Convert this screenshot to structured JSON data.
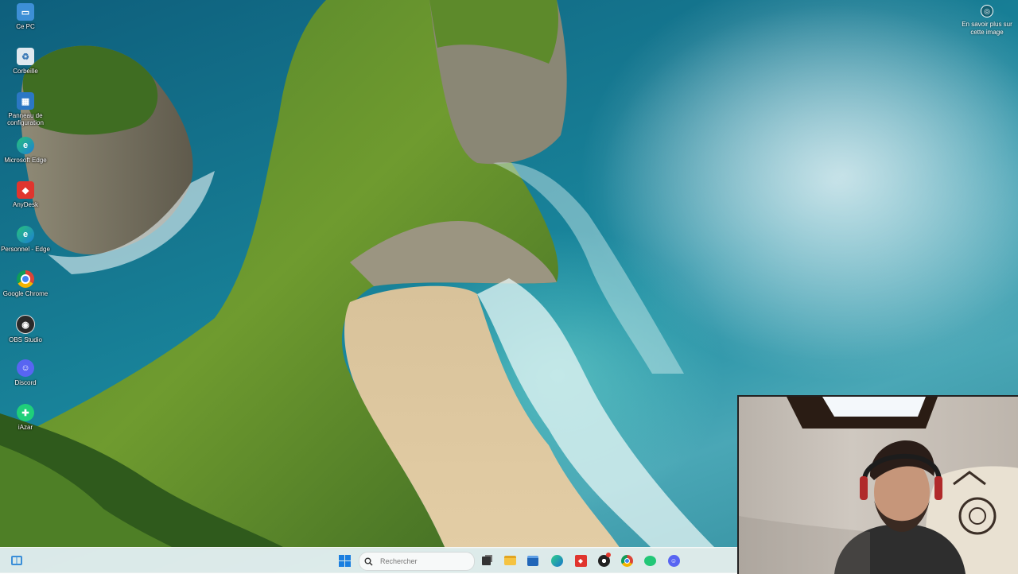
{
  "desktop": {
    "icons": [
      {
        "label": "Ce PC",
        "icon": "computer-icon"
      },
      {
        "label": "Corbeille",
        "icon": "recycle-bin-icon"
      },
      {
        "label": "Panneau de configuration",
        "icon": "control-panel-icon"
      },
      {
        "label": "Microsoft Edge",
        "icon": "edge-icon"
      },
      {
        "label": "AnyDesk",
        "icon": "anydesk-icon"
      },
      {
        "label": "Personnel - Edge",
        "icon": "edge-profile-icon"
      },
      {
        "label": "Google Chrome",
        "icon": "chrome-icon"
      },
      {
        "label": "OBS Studio",
        "icon": "obs-icon"
      },
      {
        "label": "Discord",
        "icon": "discord-icon"
      },
      {
        "label": "iAzar",
        "icon": "azar-icon"
      }
    ]
  },
  "spotlight": {
    "label": "En savoir plus sur cette image",
    "icon": "camera-info-icon"
  },
  "taskbar": {
    "widgets_icon": "widgets-icon",
    "start_icon": "windows-start-icon",
    "search_placeholder": "Rechercher",
    "apps": [
      {
        "name": "task-view-icon"
      },
      {
        "name": "file-explorer-icon"
      },
      {
        "name": "store-icon"
      },
      {
        "name": "edge-icon"
      },
      {
        "name": "anydesk-icon"
      },
      {
        "name": "obs-icon"
      },
      {
        "name": "chrome-icon"
      },
      {
        "name": "azar-icon"
      },
      {
        "name": "discord-icon"
      }
    ]
  },
  "colors": {
    "accent": "#0078d4",
    "taskbar_bg": "#e8f0ee"
  }
}
